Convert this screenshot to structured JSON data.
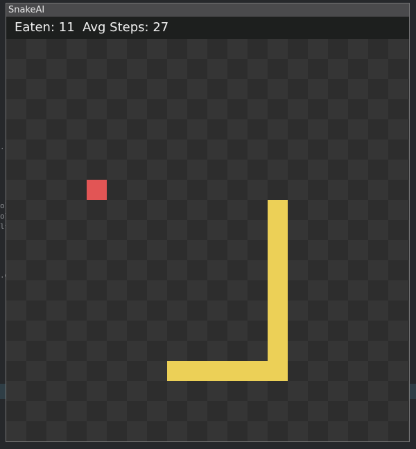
{
  "window": {
    "title": "SnakeAI"
  },
  "hud": {
    "eaten_label": "Eaten:",
    "eaten_value": "11",
    "avg_steps_label": "Avg Steps:",
    "avg_steps_value": "27"
  },
  "board": {
    "columns": 20,
    "rows": 20,
    "food": {
      "col": 4,
      "row": 7
    },
    "snake": [
      [
        13,
        8
      ],
      [
        13,
        9
      ],
      [
        13,
        10
      ],
      [
        13,
        11
      ],
      [
        13,
        12
      ],
      [
        13,
        13
      ],
      [
        13,
        14
      ],
      [
        13,
        15
      ],
      [
        13,
        16
      ],
      [
        12,
        16
      ],
      [
        11,
        16
      ],
      [
        10,
        16
      ],
      [
        9,
        16
      ],
      [
        8,
        16
      ]
    ],
    "colors": {
      "snake": "#ecd057",
      "food": "#e25555"
    }
  }
}
